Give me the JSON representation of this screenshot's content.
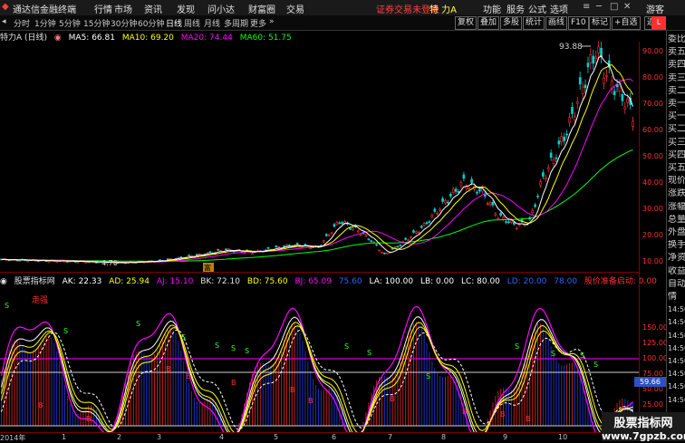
{
  "titlebar": {
    "app_name": "通达信金融终端",
    "menus": [
      "行情",
      "市场",
      "资讯",
      "发现",
      "问小达",
      "财富圈",
      "交易"
    ],
    "login_notice": "证券交易未登录",
    "stock_title": "特 力A",
    "right_menus": [
      "功能",
      "服务",
      "公式",
      "选项"
    ],
    "guest": "游客"
  },
  "toolbar": {
    "periods": [
      "分时",
      "1分钟",
      "5分钟",
      "15分钟",
      "30分钟",
      "60分钟",
      "日线",
      "周线",
      "月线",
      "多周期",
      "更多"
    ],
    "active_period": "日线",
    "right_buttons": [
      "复权",
      "叠加",
      "多股",
      "统计",
      "画线",
      "F10",
      "标记",
      "+自选",
      "返回"
    ]
  },
  "main_info": {
    "name": "特力A (日线)",
    "ma5": "MA5: 66.81",
    "ma10": "MA10: 69.20",
    "ma20": "MA20: 74.44",
    "ma60": "MA60: 51.75"
  },
  "main_axis": [
    "90.00",
    "80.00",
    "70.00",
    "60.00",
    "50.00",
    "40.00",
    "30.00",
    "20.00",
    "10.00"
  ],
  "peak_label": "93.88",
  "low_label": "4.70",
  "event_marker": "富",
  "indicator_info": {
    "name": "股票指标网",
    "ak": "AK: 22.33",
    "ad": "AD: 25.94",
    "aj": "AJ: 15.10",
    "bk": "BK: 72.10",
    "bd": "BD: 75.60",
    "bj": "BJ: 65.09",
    "v1": "75.60",
    "la": "LA: 100.00",
    "lb": "LB: 0.00",
    "lc": "LC: 80.00",
    "v2": "LD: 20.00",
    "v3": "78.00",
    "signal": "股价准备启动: 0.00",
    "mode": "走强"
  },
  "ind_axis": [
    "150.00",
    "125.00",
    "100.00",
    "75.00",
    "50.00",
    "25.00"
  ],
  "ind_current": "59.66",
  "xaxis": [
    "2014年",
    "1",
    "2",
    "3",
    "4",
    "5",
    "6",
    "7",
    "8",
    "9",
    "10",
    "11"
  ],
  "sidepanel": [
    "委比",
    "卖五",
    "卖四",
    "卖三",
    "卖二",
    "卖一",
    "买一",
    "买二",
    "买三",
    "买四",
    "买五",
    "现价",
    "涨跌",
    "涨幅",
    "总量",
    "外盘",
    "换手",
    "净资",
    "收益",
    "自动",
    "情",
    "14:50",
    "14:50",
    "14:50",
    "14:50",
    "14:50",
    "14:50",
    "14:50",
    "14:50"
  ],
  "watermark": {
    "line1": "股票指标网",
    "line2": "www.7gpzb.com"
  },
  "colors": {
    "up": "#ff3030",
    "down": "#00d0d0",
    "ma5": "#ffffff",
    "ma10": "#ffff00",
    "ma20": "#ff00ff",
    "ma60": "#00ff00"
  }
}
